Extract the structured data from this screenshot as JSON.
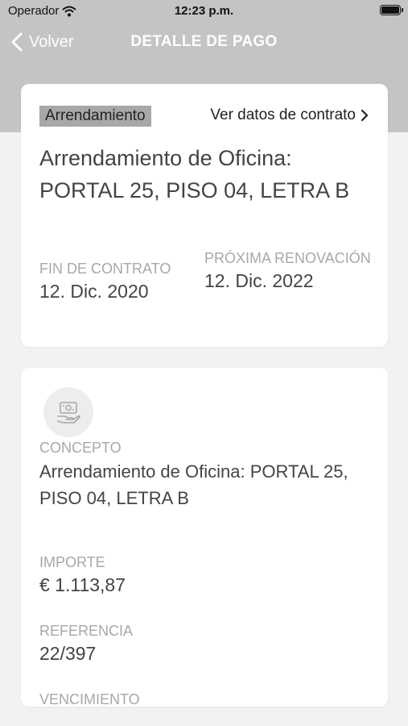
{
  "status_bar": {
    "carrier": "Operador",
    "time": "12:23 p.m."
  },
  "nav": {
    "back_label": "Volver",
    "title": "DETALLE DE PAGO"
  },
  "contract": {
    "tag": "Arrendamiento",
    "link_label": "Ver datos de contrato",
    "title": "Arrendamiento de Oficina: PORTAL 25, PISO 04, LETRA B",
    "end_label": "FIN DE CONTRATO",
    "end_value": "12. Dic. 2020",
    "renewal_label": "PRÓXIMA RENOVACIÓN",
    "renewal_value": "12. Dic. 2022"
  },
  "payment": {
    "icon": "payment-hand-icon",
    "concept_label": "CONCEPTO",
    "concept_value": "Arrendamiento de Oficina: PORTAL 25, PISO 04, LETRA B",
    "amount_label": "IMPORTE",
    "amount_value": "€ 1.113,87",
    "reference_label": "REFERENCIA",
    "reference_value": "22/397",
    "due_label": "VENCIMIENTO"
  }
}
